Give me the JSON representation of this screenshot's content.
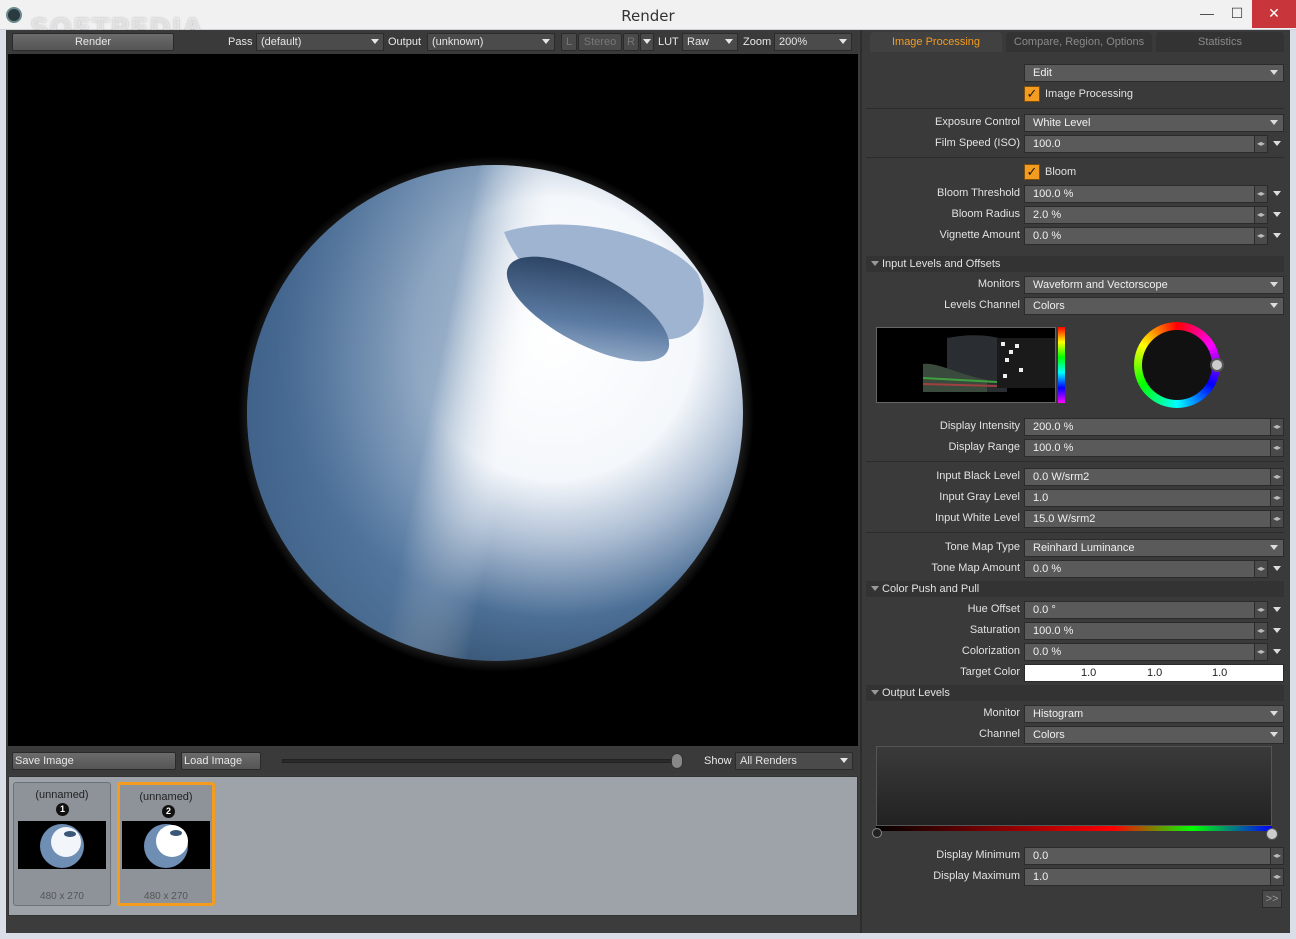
{
  "window": {
    "title": "Render",
    "watermark": "SOFTPEDIA",
    "controls": {
      "minimize": "—",
      "maximize": "☐",
      "close": "✕"
    }
  },
  "toolbar": {
    "render_label": "Render",
    "pass_label": "Pass",
    "pass_value": "(default)",
    "output_label": "Output",
    "output_value": "(unknown)",
    "l_label": "L",
    "stereo_label": "Stereo",
    "r_label": "R",
    "lut_label": "LUT",
    "lut_value": "Raw",
    "zoom_label": "Zoom",
    "zoom_value": "200%"
  },
  "bottombar": {
    "save_label": "Save Image",
    "load_label": "Load Image",
    "show_label": "Show",
    "show_value": "All Renders"
  },
  "thumbnails": [
    {
      "name": "(unnamed)",
      "num": "1",
      "size": "480 x 270",
      "selected": false
    },
    {
      "name": "(unnamed)",
      "num": "2",
      "size": "480 x 270",
      "selected": true
    }
  ],
  "tabs": [
    {
      "label": "Image Processing",
      "active": true
    },
    {
      "label": "Compare, Region, Options",
      "active": false
    },
    {
      "label": "Statistics",
      "active": false
    }
  ],
  "panel": {
    "edit_value": "Edit",
    "image_processing_label": "Image Processing",
    "exposure_control_label": "Exposure Control",
    "exposure_control_value": "White Level",
    "film_speed_label": "Film Speed (ISO)",
    "film_speed_value": "100.0",
    "bloom_label": "Bloom",
    "bloom_threshold_label": "Bloom Threshold",
    "bloom_threshold_value": "100.0 %",
    "bloom_radius_label": "Bloom Radius",
    "bloom_radius_value": "2.0 %",
    "vignette_label": "Vignette Amount",
    "vignette_value": "0.0 %",
    "section_input": "Input Levels and Offsets",
    "monitors_label": "Monitors",
    "monitors_value": "Waveform and Vectorscope",
    "levels_channel_label": "Levels Channel",
    "levels_channel_value": "Colors",
    "display_intensity_label": "Display Intensity",
    "display_intensity_value": "200.0 %",
    "display_range_label": "Display Range",
    "display_range_value": "100.0 %",
    "input_black_label": "Input Black Level",
    "input_black_value": "0.0 W/srm2",
    "input_gray_label": "Input Gray Level",
    "input_gray_value": "1.0",
    "input_white_label": "Input White Level",
    "input_white_value": "15.0 W/srm2",
    "tone_map_type_label": "Tone Map Type",
    "tone_map_type_value": "Reinhard Luminance",
    "tone_map_amount_label": "Tone Map Amount",
    "tone_map_amount_value": "0.0 %",
    "section_color": "Color Push and Pull",
    "hue_offset_label": "Hue Offset",
    "hue_offset_value": "0.0 °",
    "saturation_label": "Saturation",
    "saturation_value": "100.0 %",
    "colorization_label": "Colorization",
    "colorization_value": "0.0 %",
    "target_color_label": "Target Color",
    "target_color_r": "1.0",
    "target_color_g": "1.0",
    "target_color_b": "1.0",
    "section_output": "Output Levels",
    "monitor_label": "Monitor",
    "monitor_value": "Histogram",
    "channel_label": "Channel",
    "channel_value": "Colors",
    "display_min_label": "Display Minimum",
    "display_min_value": "0.0",
    "display_max_label": "Display Maximum",
    "display_max_value": "1.0",
    "more_label": ">>"
  },
  "colors": {
    "accent": "#f39c1f",
    "panel_bg": "#3a3a3a",
    "field_bg": "#5a5a5a"
  }
}
